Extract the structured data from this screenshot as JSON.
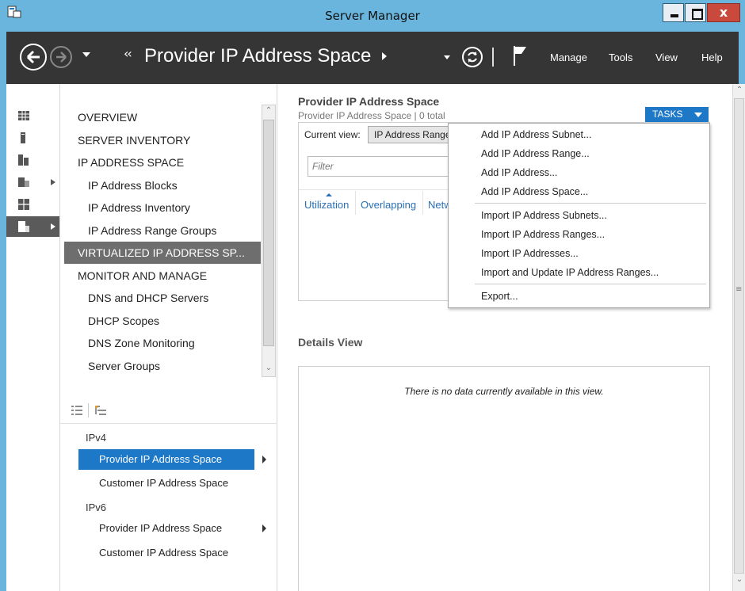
{
  "window": {
    "title": "Server Manager",
    "close_glyph": "x",
    "accent": "#6ab5dd"
  },
  "header": {
    "crumb_prefix": "‹‹",
    "title": "Provider IP Address Space",
    "menu": {
      "manage": "Manage",
      "tools": "Tools",
      "view": "View",
      "help": "Help"
    },
    "background": "#353535"
  },
  "rail": {
    "items": [
      {
        "icon": "dashboard-icon"
      },
      {
        "icon": "local-server-icon"
      },
      {
        "icon": "all-servers-icon"
      },
      {
        "icon": "file-storage-icon",
        "expandable": true
      },
      {
        "icon": "ipam-icon"
      },
      {
        "icon": "ipam-selected-icon",
        "expandable": true,
        "selected": true
      }
    ]
  },
  "nav": {
    "items": [
      {
        "label": "OVERVIEW",
        "level": 0
      },
      {
        "label": "SERVER INVENTORY",
        "level": 0
      },
      {
        "label": "IP ADDRESS SPACE",
        "level": 0
      },
      {
        "label": "IP Address Blocks",
        "level": 1
      },
      {
        "label": "IP Address Inventory",
        "level": 1
      },
      {
        "label": "IP Address Range Groups",
        "level": 1
      },
      {
        "label": "VIRTUALIZED IP ADDRESS SP...",
        "level": 0,
        "selected": true
      },
      {
        "label": "MONITOR AND MANAGE",
        "level": 0
      },
      {
        "label": "DNS and DHCP Servers",
        "level": 1
      },
      {
        "label": "DHCP Scopes",
        "level": 1
      },
      {
        "label": "DNS Zone Monitoring",
        "level": 1
      },
      {
        "label": "Server Groups",
        "level": 1
      }
    ]
  },
  "tree": {
    "groups": [
      {
        "label": "IPv4",
        "items": [
          {
            "label": "Provider IP Address Space",
            "selected": true,
            "has_arrow": true
          },
          {
            "label": "Customer IP Address Space"
          }
        ]
      },
      {
        "label": "IPv6",
        "items": [
          {
            "label": "Provider IP Address Space",
            "has_arrow": true
          },
          {
            "label": "Customer IP Address Space"
          }
        ]
      }
    ]
  },
  "main": {
    "title": "Provider IP Address Space",
    "subtitle": "Provider IP Address Space | 0 total",
    "tasks_label": "TASKS",
    "current_view_label": "Current view:",
    "current_view_value": "IP Address Range",
    "filter_placeholder": "Filter",
    "columns": [
      "Utilization",
      "Overlapping",
      "Netw"
    ],
    "details_title": "Details View",
    "details_empty": "There is no data currently available in this view."
  },
  "tasks_menu": {
    "groups": [
      [
        "Add IP Address Subnet...",
        "Add IP Address Range...",
        "Add IP Address...",
        "Add IP Address Space..."
      ],
      [
        "Import IP Address Subnets...",
        "Import IP Address Ranges...",
        "Import IP Addresses...",
        "Import and Update IP Address Ranges..."
      ],
      [
        "Export..."
      ]
    ]
  }
}
